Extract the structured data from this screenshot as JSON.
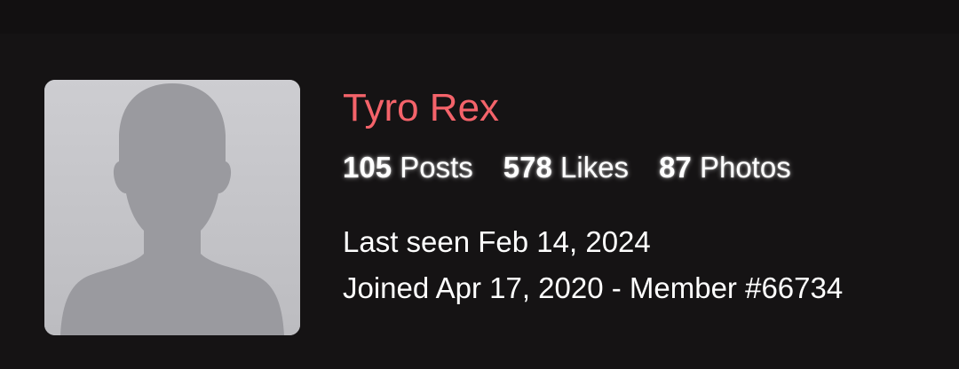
{
  "profile": {
    "name": "Tyro Rex",
    "name_color": "#f4636a",
    "avatar_icon": "default-user-silhouette-icon",
    "stats": [
      {
        "value": "105",
        "label": "Posts"
      },
      {
        "value": "578",
        "label": "Likes"
      },
      {
        "value": "87",
        "label": "Photos"
      }
    ],
    "last_seen": "Last seen Feb 14, 2024",
    "joined": "Joined Apr 17, 2020 - Member #66734"
  }
}
